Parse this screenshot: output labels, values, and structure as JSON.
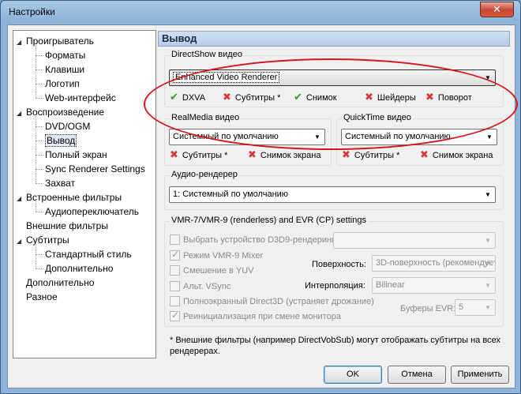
{
  "window": {
    "title": "Настройки",
    "close_label": "✕"
  },
  "tree": [
    {
      "label": "Проигрыватель",
      "level": 0,
      "expanded": true
    },
    {
      "label": "Форматы",
      "level": 1
    },
    {
      "label": "Клавиши",
      "level": 1
    },
    {
      "label": "Логотип",
      "level": 1
    },
    {
      "label": "Web-интерфейс",
      "level": 1
    },
    {
      "label": "Воспроизведение",
      "level": 0,
      "expanded": true
    },
    {
      "label": "DVD/OGM",
      "level": 1
    },
    {
      "label": "Вывод",
      "level": 1,
      "selected": true
    },
    {
      "label": "Полный экран",
      "level": 1
    },
    {
      "label": "Sync Renderer Settings",
      "level": 1
    },
    {
      "label": "Захват",
      "level": 1
    },
    {
      "label": "Встроенные фильтры",
      "level": 0,
      "expanded": true
    },
    {
      "label": "Аудиопереключатель",
      "level": 1
    },
    {
      "label": "Внешние фильтры",
      "level": 0
    },
    {
      "label": "Субтитры",
      "level": 0,
      "expanded": true
    },
    {
      "label": "Стандартный стиль",
      "level": 1
    },
    {
      "label": "Дополнительно",
      "level": 1
    },
    {
      "label": "Дополнительно",
      "level": 0
    },
    {
      "label": "Разное",
      "level": 0
    }
  ],
  "page": {
    "header": "Вывод",
    "directshow": {
      "title": "DirectShow видео",
      "value": "Enhanced Video Renderer",
      "features": [
        {
          "label": "DXVA",
          "ok": true
        },
        {
          "label": "Субтитры *",
          "ok": false
        },
        {
          "label": "Снимок",
          "ok": true
        },
        {
          "label": "Шейдеры",
          "ok": false
        },
        {
          "label": "Поворот",
          "ok": false
        }
      ]
    },
    "realmedia": {
      "title": "RealMedia видео",
      "value": "Системный по умолчанию",
      "features": [
        {
          "label": "Субтитры *",
          "ok": false
        },
        {
          "label": "Снимок экрана",
          "ok": false
        }
      ]
    },
    "quicktime": {
      "title": "QuickTime видео",
      "value": "Системный по умолчанию",
      "features": [
        {
          "label": "Субтитры *",
          "ok": false
        },
        {
          "label": "Снимок экрана",
          "ok": false
        }
      ]
    },
    "audio": {
      "title": "Аудио-рендерер",
      "value": "1: Системный по умолчанию"
    },
    "vmr": {
      "title": "VMR-7/VMR-9 (renderless) and EVR (CP) settings",
      "d3d_device_label": "Выбрать устройство D3D9-рендеринга",
      "d3d_device_value": "",
      "vmr9_mixer_label": "Режим VMR-9 Mixer",
      "yuv_mixing_label": "Смешение в YUV",
      "alt_vsync_label": "Альт. VSync",
      "fullscreen_d3d_label": "Полноэкранный Direct3D (устраняет дрожание)",
      "reinit_label": "Реинициализация при смене монитора",
      "surface_label": "Поверхность:",
      "surface_value": "3D-поверхность (рекомендуется)",
      "interpolation_label": "Интерполяция:",
      "interpolation_value": "Bilinear",
      "evr_buffers_label": "Буферы EVR:",
      "evr_buffers_value": "5",
      "vmr9_mixer_checked": true,
      "reinit_checked": true
    },
    "note": "* Внешние фильтры (например DirectVobSub) могут отображать субтитры на всех рендерерах."
  },
  "buttons": {
    "ok": "OK",
    "cancel": "Отмена",
    "apply": "Применить"
  },
  "colors": {
    "annotation_ellipse": "#d8141b",
    "ok_icon": "#3a9a28",
    "fail_icon": "#d23a3a"
  }
}
